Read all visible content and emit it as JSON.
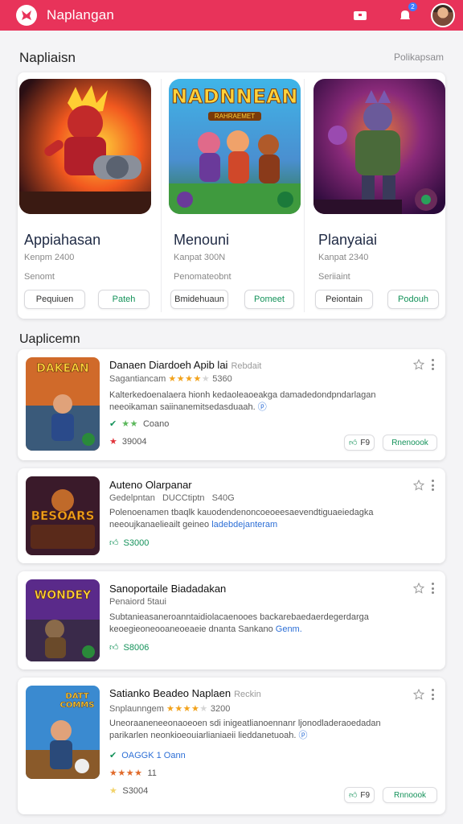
{
  "header": {
    "app_title": "Naplangan",
    "bg_color": "#e8335a",
    "notification_count": "2",
    "icons": [
      "app-logo-icon",
      "store-icon",
      "notification-icon",
      "avatar"
    ]
  },
  "featured": {
    "section_title": "Napliaisn",
    "see_all": "Polikapsam",
    "cards": [
      {
        "name": "Appiahasan",
        "meta": "Kenpm 2400",
        "sub": "Senomt",
        "btn_left": "Pequiuen",
        "btn_right": "Pateh"
      },
      {
        "name": "Menouni",
        "meta": "Kanpat 300N",
        "sub": "Penomateobnt",
        "btn_left": "Bmidehuaun",
        "btn_right": "Pomeet"
      },
      {
        "name": "Planyaiai",
        "meta": "Kanpat 2340",
        "sub": "Seriiaint",
        "btn_left": "Peiontain",
        "btn_right": "Podouh"
      }
    ],
    "card2_logo_text": "NADNNEAN",
    "card2_logo_sub": "RAHRAEMET"
  },
  "list": {
    "section_title": "Uaplicemn",
    "items": [
      {
        "title": "Danaen Diardoeh Apib lai",
        "tag": "Rebdait",
        "subtitle": "Sagantiancam",
        "stars": "★★★★",
        "stars_dim": "★",
        "rating_count": "5360",
        "desc": "Kalterkedoenalaera hionh kedaoleaoeakga damadedondpndarlagan neeoikaman saiinanemitsedasduaah.",
        "link": "",
        "secondary": "Coano",
        "rating_line": "39004",
        "pill_left": "F9",
        "pill_right": "Rnenoook",
        "thumb_text": "DAKEAN"
      },
      {
        "title": "Auteno Olarpanar",
        "tag": "",
        "subtitle": "Gedelpntan",
        "stars": "DUCCtiptn",
        "stars_dim": "",
        "rating_count": "S40G",
        "desc": "Polenoenamen tbaqlk kauodendenoncoeoeesaevendtiguaeiedagka neeoujkanaelieailt geineo",
        "link": "ladebdejanteram",
        "secondary": "",
        "rating_line": "S3000",
        "pill_left": "",
        "pill_right": "",
        "thumb_text": "BESOARS"
      },
      {
        "title": "Sanoportaile Biadadakan",
        "tag": "",
        "subtitle": "Penaiord 5taui",
        "stars": "",
        "stars_dim": "",
        "rating_count": "",
        "desc": "Subtanieasaneroanntaidiolacaenooes backarebaedaerdegerdarga keoegieoneooaneoeaeie dnanta Sankano",
        "link": "Genm.",
        "secondary": "",
        "rating_line": "S8006",
        "pill_left": "",
        "pill_right": "",
        "thumb_text": "WONDEY"
      },
      {
        "title": "Satianko Beadeo Naplaen",
        "tag": "Reckin",
        "subtitle": "Snplaunngem",
        "stars": "★★★★",
        "stars_dim": "★",
        "rating_count": "3200",
        "desc": "Uneoraaneneeonaoeoen sdi inigeatlianoennanr ljonodladeraoedadan parikarlen neonkioeouiarlianiaeii lieddanetuoah.",
        "link": "",
        "secondary": "OAGGK 1 Oann",
        "stars_small": "★★★★",
        "stars_small_count": "11",
        "rating_line": "S3004",
        "pill_left": "F9",
        "pill_right": "Rnnoook",
        "thumb_text": "DATT COMMS"
      }
    ]
  },
  "colors": {
    "accent": "#e8335a",
    "green": "#14925a",
    "star": "#f2a21b",
    "link": "#2d6fd6"
  }
}
